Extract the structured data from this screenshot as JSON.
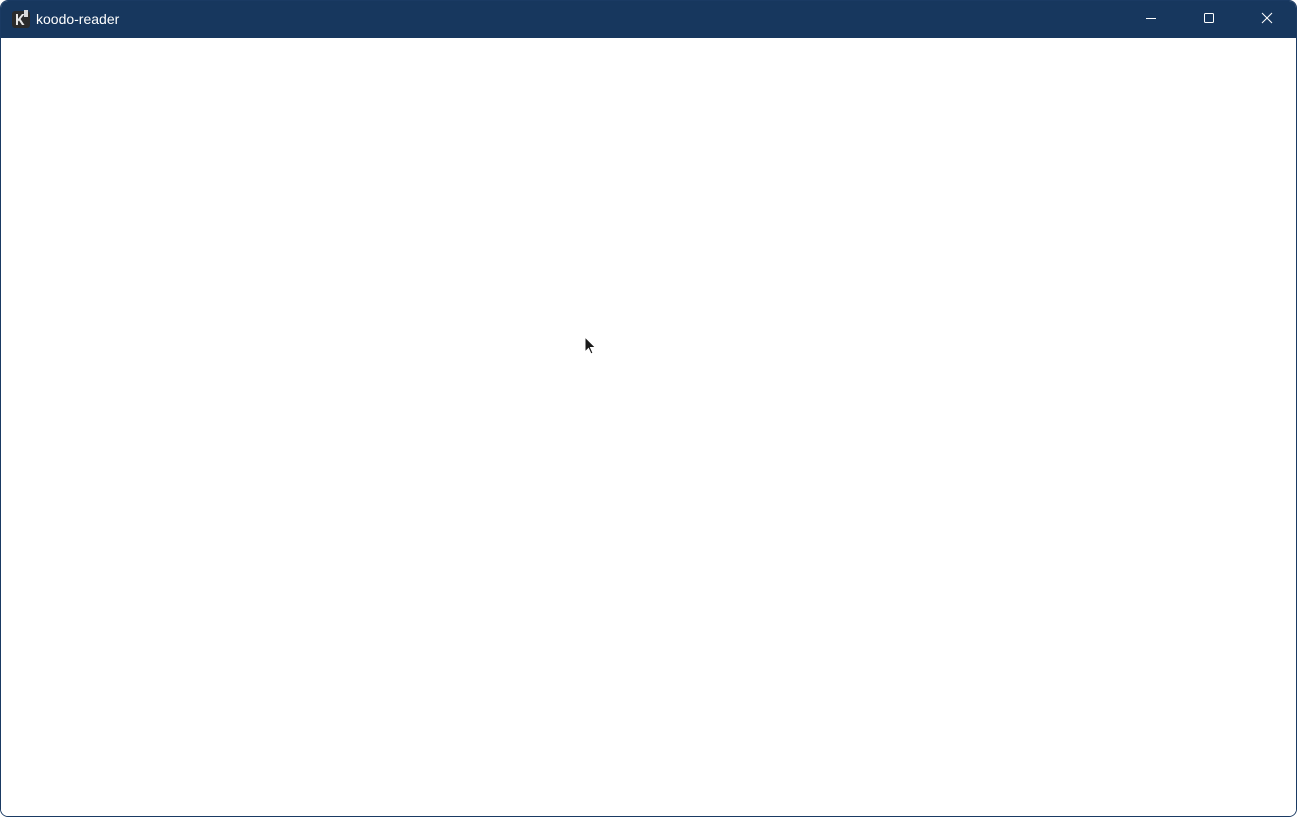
{
  "window": {
    "title": "koodo-reader",
    "app_icon": "koodo-reader-app-icon",
    "titlebar_color": "#17375e",
    "controls": {
      "minimize_icon": "minimize-icon",
      "maximize_icon": "maximize-icon",
      "close_icon": "close-icon"
    }
  },
  "content": {
    "state": "blank",
    "background": "#ffffff"
  },
  "pointer": {
    "icon": "mouse-cursor-icon"
  }
}
